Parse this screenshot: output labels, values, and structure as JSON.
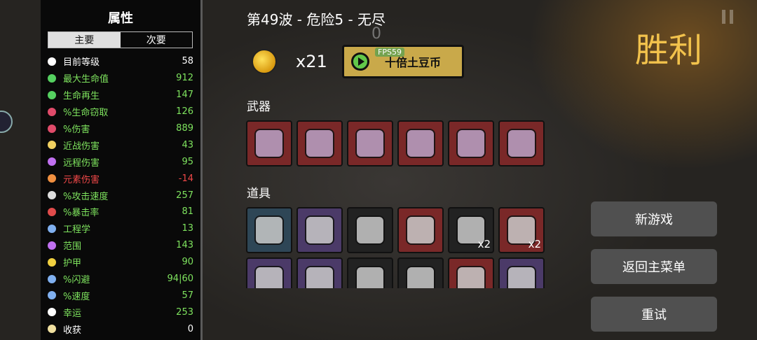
{
  "stats": {
    "title": "属性",
    "tabs": [
      {
        "label": "主要",
        "active": true
      },
      {
        "label": "次要",
        "active": false
      }
    ],
    "items": [
      {
        "label": "目前等级",
        "value": "58",
        "tone": "neutral",
        "icon_color": "#ffffff",
        "icon": "level-icon"
      },
      {
        "label": "最大生命值",
        "value": "912",
        "tone": "pos",
        "icon_color": "#55d060",
        "icon": "heart-icon"
      },
      {
        "label": "生命再生",
        "value": "147",
        "tone": "pos",
        "icon_color": "#55d060",
        "icon": "regen-icon"
      },
      {
        "label": "%生命窃取",
        "value": "126",
        "tone": "pos",
        "icon_color": "#e04b6a",
        "icon": "fangs-icon"
      },
      {
        "label": "%伤害",
        "value": "889",
        "tone": "pos",
        "icon_color": "#e04b6a",
        "icon": "muscle-icon"
      },
      {
        "label": "近战伤害",
        "value": "43",
        "tone": "pos",
        "icon_color": "#f0d060",
        "icon": "sword-icon"
      },
      {
        "label": "远程伤害",
        "value": "95",
        "tone": "pos",
        "icon_color": "#c070f0",
        "icon": "bow-icon"
      },
      {
        "label": "元素伤害",
        "value": "-14",
        "tone": "neg",
        "icon_color": "#f09040",
        "icon": "flame-icon"
      },
      {
        "label": "%攻击速度",
        "value": "257",
        "tone": "pos",
        "icon_color": "#dddddd",
        "icon": "hourglass-icon"
      },
      {
        "label": "%暴击率",
        "value": "81",
        "tone": "pos",
        "icon_color": "#e04b4b",
        "icon": "crit-icon"
      },
      {
        "label": "工程学",
        "value": "13",
        "tone": "pos",
        "icon_color": "#80b0f0",
        "icon": "wrench-icon"
      },
      {
        "label": "范围",
        "value": "143",
        "tone": "pos",
        "icon_color": "#c070f0",
        "icon": "range-icon"
      },
      {
        "label": "护甲",
        "value": "90",
        "tone": "pos",
        "icon_color": "#f0d040",
        "icon": "shield-icon"
      },
      {
        "label": "%闪避",
        "value": "94|60",
        "tone": "pos",
        "icon_color": "#80b0f0",
        "icon": "dodge-icon"
      },
      {
        "label": "%速度",
        "value": "57",
        "tone": "pos",
        "icon_color": "#80b0f0",
        "icon": "speed-icon"
      },
      {
        "label": "幸运",
        "value": "253",
        "tone": "pos",
        "icon_color": "#ffffff",
        "icon": "dice-icon"
      },
      {
        "label": "收获",
        "value": "0",
        "tone": "neutral",
        "icon_color": "#f0e0a0",
        "icon": "harvest-icon"
      }
    ]
  },
  "header": {
    "wave_text": "第49波 - 危险5 - 无尽",
    "coins": "x21",
    "tenx_button": "十倍土豆币",
    "fps": "FPS59",
    "overlay_zero": "0"
  },
  "weapons": {
    "label": "武器",
    "items": [
      {
        "name": "weapon-1",
        "tier": "weapon"
      },
      {
        "name": "weapon-2",
        "tier": "weapon"
      },
      {
        "name": "weapon-3",
        "tier": "weapon"
      },
      {
        "name": "weapon-4",
        "tier": "weapon"
      },
      {
        "name": "weapon-5",
        "tier": "weapon"
      },
      {
        "name": "weapon-6",
        "tier": "weapon"
      }
    ]
  },
  "items": {
    "label": "道具",
    "row1": [
      {
        "tier": "tier-blue",
        "qty": ""
      },
      {
        "tier": "tier-purple",
        "qty": ""
      },
      {
        "tier": "tier-dark",
        "qty": ""
      },
      {
        "tier": "tier-red",
        "qty": ""
      },
      {
        "tier": "tier-dark",
        "qty": "x2"
      },
      {
        "tier": "tier-red",
        "qty": "x2"
      }
    ],
    "row2": [
      {
        "tier": "tier-purple",
        "qty": ""
      },
      {
        "tier": "tier-purple",
        "qty": ""
      },
      {
        "tier": "tier-dark",
        "qty": ""
      },
      {
        "tier": "tier-dark",
        "qty": ""
      },
      {
        "tier": "tier-red",
        "qty": ""
      },
      {
        "tier": "tier-purple",
        "qty": ""
      }
    ]
  },
  "result": {
    "title": "胜利",
    "new_game": "新游戏",
    "main_menu": "返回主菜单",
    "retry": "重试"
  }
}
